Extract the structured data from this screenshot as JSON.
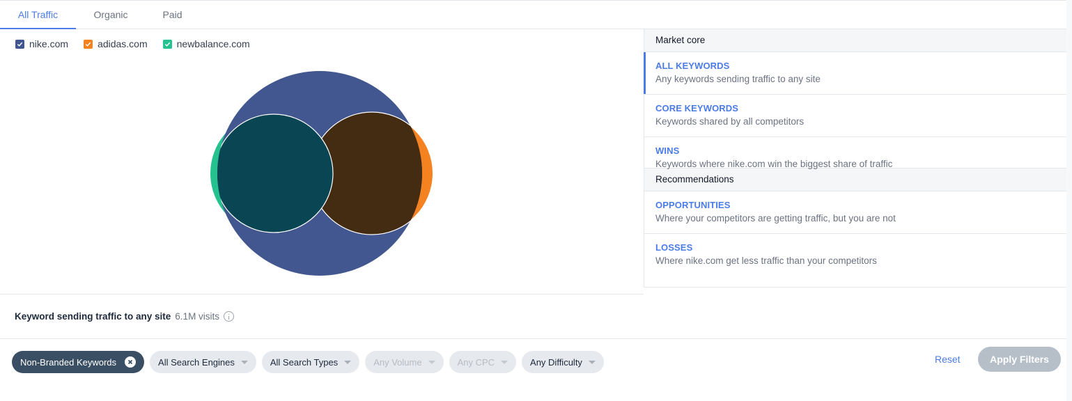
{
  "tabs": [
    {
      "label": "All Traffic",
      "active": true
    },
    {
      "label": "Organic",
      "active": false
    },
    {
      "label": "Paid",
      "active": false
    }
  ],
  "legend": [
    {
      "label": "nike.com",
      "color": "#42578f",
      "checked": true
    },
    {
      "label": "adidas.com",
      "color": "#f58220",
      "checked": true
    },
    {
      "label": "newbalance.com",
      "color": "#25c18e",
      "checked": true
    }
  ],
  "venn": {
    "colors": {
      "nike": "#42578f",
      "adidas": "#f58220",
      "newbalance": "#25c18e",
      "nike_newbalance": "#094552",
      "nike_adidas": "#432c11",
      "stroke": "#ffffff"
    }
  },
  "chart_data": {
    "type": "venn",
    "title": "",
    "sets": [
      {
        "name": "nike.com",
        "relative_size": 1.0
      },
      {
        "name": "adidas.com",
        "relative_size": 0.35
      },
      {
        "name": "newbalance.com",
        "relative_size": 0.35
      }
    ],
    "overlaps": [
      {
        "sets": [
          "nike.com",
          "newbalance.com"
        ],
        "note": "mostly contained"
      },
      {
        "sets": [
          "nike.com",
          "adidas.com"
        ],
        "note": "mostly contained"
      },
      {
        "sets": [
          "adidas.com",
          "newbalance.com"
        ],
        "note": "small overlap"
      }
    ],
    "legend_position": "top-left"
  },
  "right_panel": {
    "sections": [
      {
        "header": "Market core",
        "items": [
          {
            "title": "ALL KEYWORDS",
            "desc": "Any keywords sending traffic to any site",
            "active": true
          },
          {
            "title": "CORE KEYWORDS",
            "desc": "Keywords shared by all competitors",
            "active": false
          },
          {
            "title": "WINS",
            "desc": "Keywords where nike.com win the biggest share of traffic",
            "active": false
          }
        ]
      },
      {
        "header": "Recommendations",
        "items": [
          {
            "title": "OPPORTUNITIES",
            "desc": "Where your competitors are getting traffic, but you are not",
            "active": false
          },
          {
            "title": "LOSSES",
            "desc": "Where nike.com get less traffic than your competitors",
            "active": false
          }
        ]
      }
    ]
  },
  "summary": {
    "title": "Keyword sending traffic to any site",
    "value": "6.1M visits",
    "info_icon": "info-icon"
  },
  "filters": {
    "chips": [
      {
        "label": "Non-Branded Keywords",
        "style": "dark",
        "icon": "close-icon"
      },
      {
        "label": "All Search Engines",
        "style": "normal",
        "icon": "caret-down-icon"
      },
      {
        "label": "All Search Types",
        "style": "normal",
        "icon": "caret-down-icon"
      },
      {
        "label": "Any Volume",
        "style": "disabled",
        "icon": "caret-down-icon"
      },
      {
        "label": "Any CPC",
        "style": "disabled",
        "icon": "caret-down-icon"
      },
      {
        "label": "Any Difficulty",
        "style": "normal",
        "icon": "caret-down-icon"
      }
    ],
    "reset_label": "Reset",
    "apply_label": "Apply Filters"
  }
}
